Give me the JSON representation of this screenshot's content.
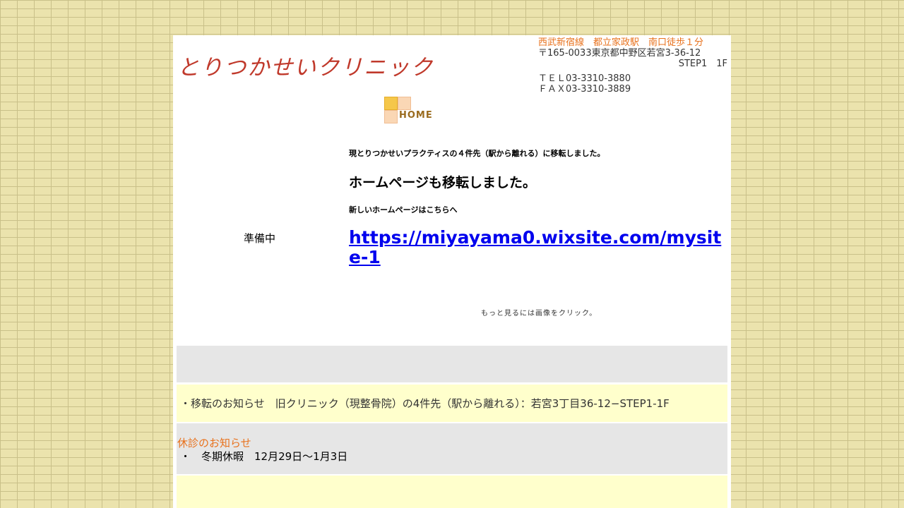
{
  "header": {
    "title": "とりつかせいクリニック",
    "access": "西武新宿線　都立家政駅　南口徒歩１分",
    "address": "〒165-0033東京都中野区若宮3-36-12",
    "building": "STEP1　1F",
    "tel": "ＴＥＬ03-3310-3880",
    "fax": "ＦＡＸ03-3310-3889"
  },
  "nav": {
    "home_label": "HOME"
  },
  "main": {
    "move_notice": "現とりつかせいプラクティスの４件先（駅から離れる）に移転しました。",
    "homepage_moved": "ホームページも移転しました。",
    "new_homepage": "新しいホームページはこちらへ",
    "preparing": "準備中",
    "link_url": "https://miyayama0.wixsite.com/mysite-1",
    "image_hint": "もっと見るには画像をクリック。"
  },
  "notices": {
    "relocation": "・移転のお知らせ　旧クリニック（現整骨院）の4件先（駅から離れる）：若宮3丁目36-12−STEP1-1F",
    "holiday_title": "休診のお知らせ",
    "holiday_item": "・　冬期休暇　12月29日〜1月3日"
  },
  "colors": {
    "title": "#c0392b",
    "accent_orange": "#e8711c",
    "link": "#0000ee",
    "band_gray": "#e6e6e6",
    "band_yellow": "#ffffcc"
  }
}
